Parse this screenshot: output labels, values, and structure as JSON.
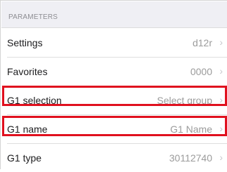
{
  "section": {
    "title": "PARAMETERS"
  },
  "rows": [
    {
      "label": "Settings",
      "value": "d12r",
      "chevron": "›"
    },
    {
      "label": "Favorites",
      "value": "0000",
      "chevron": "›"
    },
    {
      "label": "G1 selection",
      "value": "Select group",
      "chevron": "›"
    },
    {
      "label": "G1 name",
      "value": "G1 Name",
      "chevron": "›"
    },
    {
      "label": "G1 type",
      "value": "30112740",
      "chevron": "›"
    }
  ],
  "colors": {
    "highlight": "#e0101e",
    "header_bg": "#efeff4",
    "value_text": "#9b9b9b"
  }
}
